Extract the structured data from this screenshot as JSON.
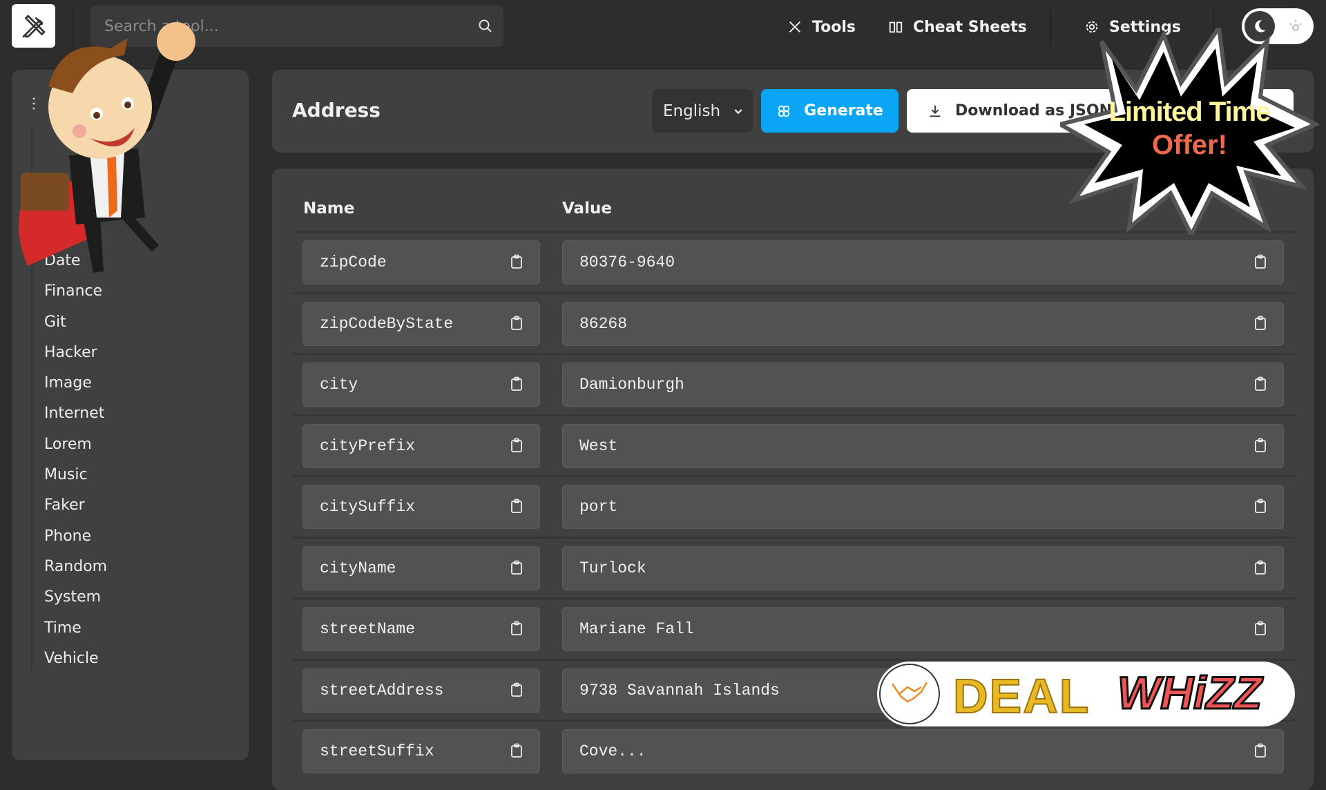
{
  "header": {
    "logo_icon": "tools-icon",
    "search_placeholder": "Search a tool...",
    "nav": [
      {
        "label": "Tools",
        "icon": "tools-icon"
      },
      {
        "label": "Cheat Sheets",
        "icon": "book-icon"
      },
      {
        "label": "Settings",
        "icon": "gear-icon"
      }
    ],
    "theme_toggle": {
      "state": "dark",
      "icons": [
        "moon-icon",
        "sun-icon"
      ]
    }
  },
  "sidebar": {
    "items": [
      {
        "label": "Date"
      },
      {
        "label": "Finance"
      },
      {
        "label": "Git"
      },
      {
        "label": "Hacker"
      },
      {
        "label": "Image"
      },
      {
        "label": "Internet"
      },
      {
        "label": "Lorem"
      },
      {
        "label": "Music"
      },
      {
        "label": "Faker"
      },
      {
        "label": "Phone"
      },
      {
        "label": "Random"
      },
      {
        "label": "System"
      },
      {
        "label": "Time"
      },
      {
        "label": "Vehicle"
      }
    ]
  },
  "main": {
    "title": "Address",
    "language": {
      "selected": "English"
    },
    "generate_label": "Generate",
    "download_label": "Download as JSON",
    "accent_color": "#0aa5f5",
    "table": {
      "headers": {
        "name": "Name",
        "value": "Value"
      },
      "rows": [
        {
          "name": "zipCode",
          "value": "80376-9640"
        },
        {
          "name": "zipCodeByState",
          "value": "86268"
        },
        {
          "name": "city",
          "value": "Damionburgh"
        },
        {
          "name": "cityPrefix",
          "value": "West"
        },
        {
          "name": "citySuffix",
          "value": "port"
        },
        {
          "name": "cityName",
          "value": "Turlock"
        },
        {
          "name": "streetName",
          "value": "Mariane Fall"
        },
        {
          "name": "streetAddress",
          "value": "9738 Savannah Islands"
        },
        {
          "name": "streetSuffix",
          "value": "Cove..."
        }
      ]
    }
  },
  "ads": {
    "burst": {
      "line1": "Limited Time",
      "line2": "Offer!"
    },
    "deal": {
      "word1": "DEAL",
      "word2": "WHiZZ"
    }
  }
}
